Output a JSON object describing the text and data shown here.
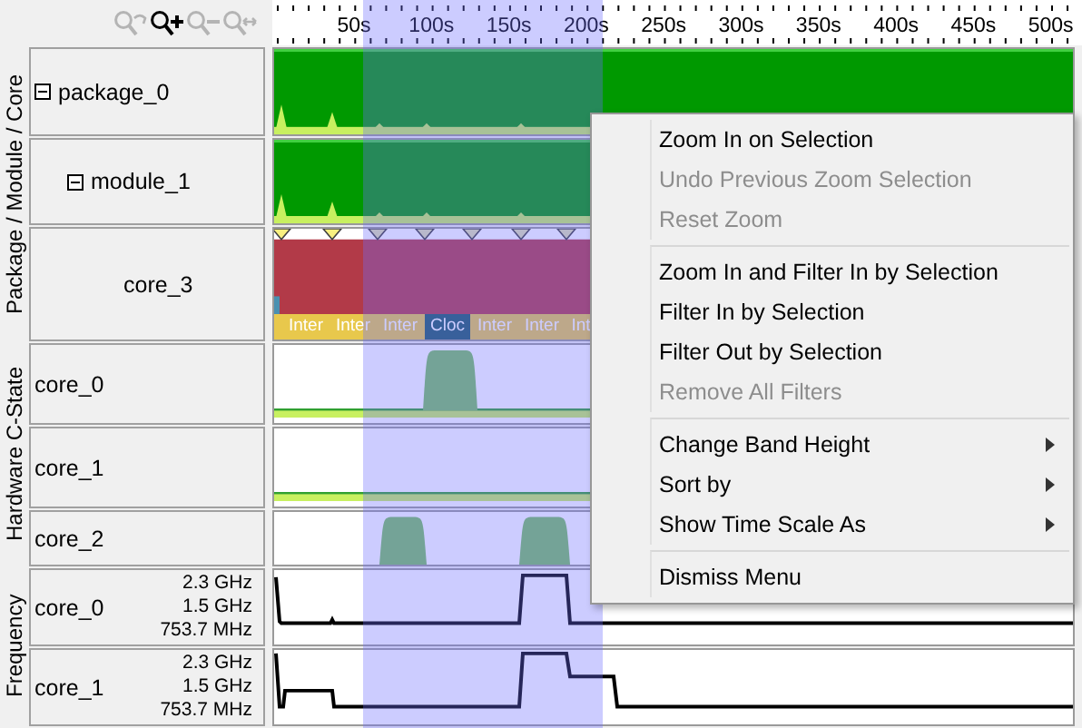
{
  "toolbar": {
    "buttons": [
      {
        "kind": "zoom_undo",
        "disabled": true
      },
      {
        "kind": "zoom_in",
        "disabled": false
      },
      {
        "kind": "zoom_out",
        "disabled": true
      },
      {
        "kind": "zoom_fit",
        "disabled": true
      }
    ]
  },
  "ruler": {
    "labels": [
      "50s",
      "100s",
      "150s",
      "200s",
      "250s",
      "300s",
      "350s",
      "400s",
      "450s",
      "500s"
    ]
  },
  "groups": [
    {
      "title": "Package / Module / Core",
      "rows": [
        {
          "label": "package_0",
          "kind": "package",
          "expanded": true
        },
        {
          "label": "module_1",
          "kind": "module",
          "expanded": true
        },
        {
          "label": "core_3",
          "kind": "core",
          "segments": [
            {
              "label": "Inter",
              "kind": "light"
            },
            {
              "label": "Inter",
              "kind": "light"
            },
            {
              "label": "Inter",
              "kind": "light"
            },
            {
              "label": "Cloc",
              "kind": "dark"
            },
            {
              "label": "Inter",
              "kind": "light"
            },
            {
              "label": "Inter",
              "kind": "light"
            },
            {
              "label": "Int",
              "kind": "light"
            }
          ]
        }
      ]
    },
    {
      "title": "Hardware C-State",
      "rows": [
        {
          "label": "core_0",
          "kind": "cstate"
        },
        {
          "label": "core_1",
          "kind": "cstate"
        },
        {
          "label": "core_2",
          "kind": "cstate"
        }
      ]
    },
    {
      "title": "Frequency",
      "rows": [
        {
          "label": "core_0",
          "kind": "frequency",
          "scale": [
            "2.3 GHz",
            "1.5 GHz",
            "753.7 MHz"
          ]
        },
        {
          "label": "core_1",
          "kind": "frequency",
          "scale": [
            "2.3 GHz",
            "1.5 GHz",
            "753.7 MHz"
          ]
        }
      ]
    }
  ],
  "context_menu": {
    "groups": [
      [
        {
          "label": "Zoom In on Selection",
          "disabled": false,
          "submenu": false
        },
        {
          "label": "Undo Previous Zoom Selection",
          "disabled": true,
          "submenu": false
        },
        {
          "label": "Reset Zoom",
          "disabled": true,
          "submenu": false
        }
      ],
      [
        {
          "label": "Zoom In and Filter In by Selection",
          "disabled": false,
          "submenu": false
        },
        {
          "label": "Filter In by Selection",
          "disabled": false,
          "submenu": false
        },
        {
          "label": "Filter Out by Selection",
          "disabled": false,
          "submenu": false
        },
        {
          "label": "Remove All Filters",
          "disabled": true,
          "submenu": false
        }
      ],
      [
        {
          "label": "Change Band Height",
          "disabled": false,
          "submenu": true
        },
        {
          "label": "Sort by",
          "disabled": false,
          "submenu": true
        },
        {
          "label": "Show Time Scale As",
          "disabled": false,
          "submenu": true
        }
      ],
      [
        {
          "label": "Dismiss Menu",
          "disabled": false,
          "submenu": false
        }
      ]
    ]
  }
}
